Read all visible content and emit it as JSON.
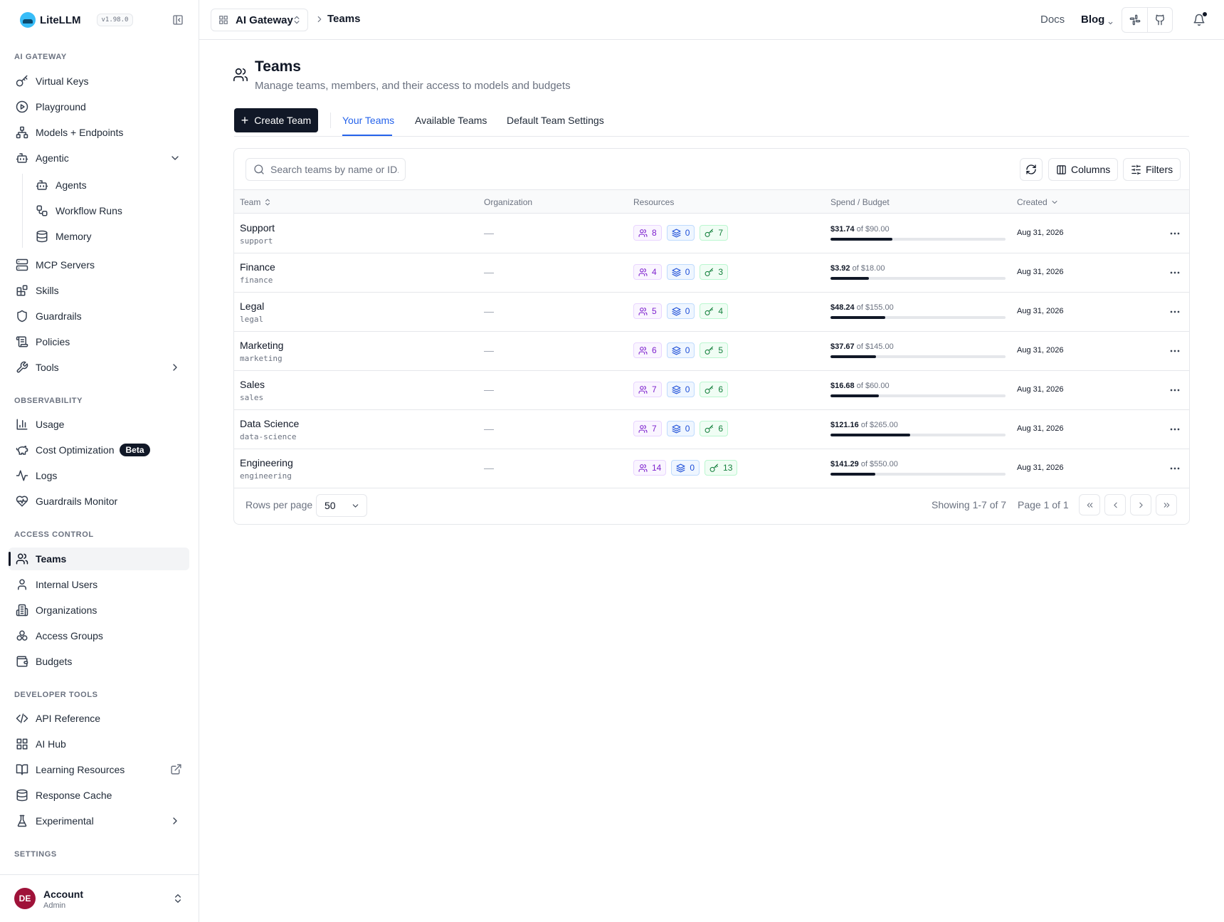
{
  "app": {
    "name": "LiteLLM",
    "version": "v1.98.0"
  },
  "sidebar": {
    "sections": {
      "ai_gateway": "AI GATEWAY",
      "observability": "OBSERVABILITY",
      "access_control": "ACCESS CONTROL",
      "developer_tools": "DEVELOPER TOOLS",
      "settings": "SETTINGS"
    },
    "items": {
      "virtual_keys": "Virtual Keys",
      "playground": "Playground",
      "models_endpoints": "Models + Endpoints",
      "agentic": "Agentic",
      "agents": "Agents",
      "workflow_runs": "Workflow Runs",
      "memory": "Memory",
      "mcp_servers": "MCP Servers",
      "skills": "Skills",
      "guardrails": "Guardrails",
      "policies": "Policies",
      "tools": "Tools",
      "usage": "Usage",
      "cost_optimization": "Cost Optimization",
      "cost_optimization_badge": "Beta",
      "logs": "Logs",
      "guardrails_monitor": "Guardrails Monitor",
      "teams": "Teams",
      "internal_users": "Internal Users",
      "organizations": "Organizations",
      "access_groups": "Access Groups",
      "budgets": "Budgets",
      "api_reference": "API Reference",
      "ai_hub": "AI Hub",
      "learning_resources": "Learning Resources",
      "response_cache": "Response Cache",
      "experimental": "Experimental"
    },
    "account": {
      "initials": "DE",
      "name": "Account",
      "role": "Admin"
    }
  },
  "topbar": {
    "gateway_select": "AI Gateway",
    "breadcrumb": "Teams",
    "docs": "Docs",
    "blog": "Blog"
  },
  "page": {
    "title": "Teams",
    "subtitle": "Manage teams, members, and their access to models and budgets",
    "create_button": "Create Team",
    "tabs": [
      "Your Teams",
      "Available Teams",
      "Default Team Settings"
    ],
    "active_tab": "Your Teams"
  },
  "toolbar": {
    "search_placeholder": "Search teams by name or ID.",
    "columns_label": "Columns",
    "filters_label": "Filters"
  },
  "table": {
    "columns": {
      "team": "Team",
      "organization": "Organization",
      "resources": "Resources",
      "spend_budget": "Spend / Budget",
      "created": "Created"
    },
    "rows": [
      {
        "name": "Support",
        "id": "support",
        "org": "—",
        "members": "8",
        "models": "0",
        "keys": "7",
        "spend": "$31.74",
        "budget": "of $90.00",
        "ratio": 0.3527,
        "created": "Aug 31, 2026"
      },
      {
        "name": "Finance",
        "id": "finance",
        "org": "—",
        "members": "4",
        "models": "0",
        "keys": "3",
        "spend": "$3.92",
        "budget": "of $18.00",
        "ratio": 0.2178,
        "created": "Aug 31, 2026"
      },
      {
        "name": "Legal",
        "id": "legal",
        "org": "—",
        "members": "5",
        "models": "0",
        "keys": "4",
        "spend": "$48.24",
        "budget": "of $155.00",
        "ratio": 0.3112,
        "created": "Aug 31, 2026"
      },
      {
        "name": "Marketing",
        "id": "marketing",
        "org": "—",
        "members": "6",
        "models": "0",
        "keys": "5",
        "spend": "$37.67",
        "budget": "of $145.00",
        "ratio": 0.2598,
        "created": "Aug 31, 2026"
      },
      {
        "name": "Sales",
        "id": "sales",
        "org": "—",
        "members": "7",
        "models": "0",
        "keys": "6",
        "spend": "$16.68",
        "budget": "of $60.00",
        "ratio": 0.278,
        "created": "Aug 31, 2026"
      },
      {
        "name": "Data Science",
        "id": "data-science",
        "org": "—",
        "members": "7",
        "models": "0",
        "keys": "6",
        "spend": "$121.16",
        "budget": "of $265.00",
        "ratio": 0.4572,
        "created": "Aug 31, 2026"
      },
      {
        "name": "Engineering",
        "id": "engineering",
        "org": "—",
        "members": "14",
        "models": "0",
        "keys": "13",
        "spend": "$141.29",
        "budget": "of $550.00",
        "ratio": 0.2569,
        "created": "Aug 31, 2026"
      }
    ]
  },
  "pagination": {
    "rows_per_page_label": "Rows per page",
    "rows_per_page": "50",
    "showing": "Showing 1-7 of 7",
    "page": "Page 1 of 1"
  }
}
